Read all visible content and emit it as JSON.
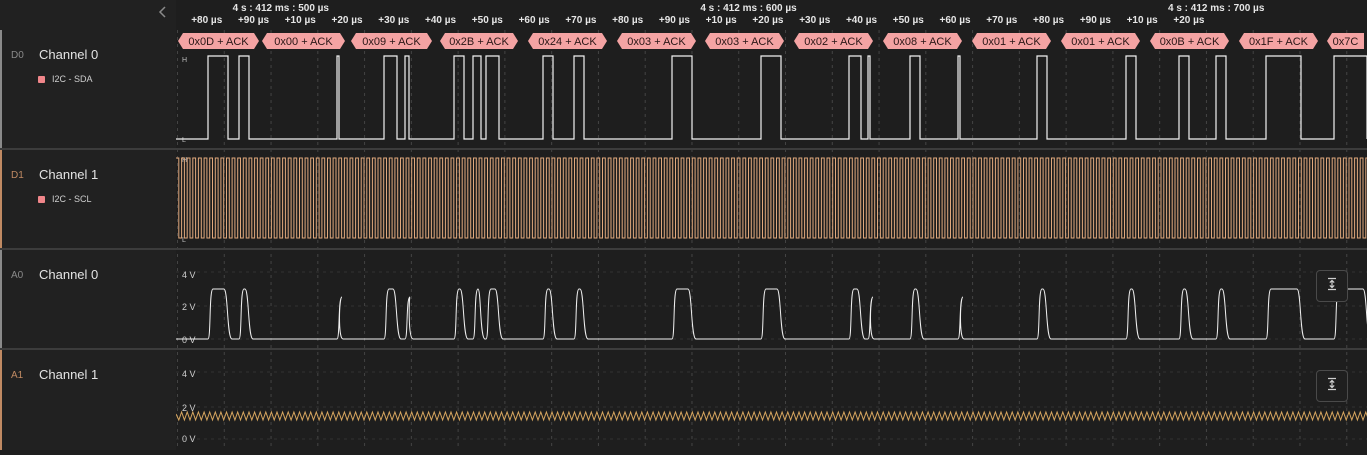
{
  "timeline": {
    "major_labels": [
      "4 s : 412 ms : 500 µs",
      "4 s : 412 ms : 600 µs",
      "4 s : 412 ms : 700 µs"
    ],
    "minor_labels": [
      "+80 µs",
      "+90 µs",
      "+10 µs",
      "+20 µs",
      "+30 µs",
      "+40 µs",
      "+50 µs",
      "+60 µs",
      "+70 µs",
      "+80 µs",
      "+90 µs",
      "+10 µs",
      "+20 µs",
      "+30 µs",
      "+40 µs",
      "+50 µs",
      "+60 µs",
      "+70 µs",
      "+80 µs",
      "+90 µs",
      "+10 µs",
      "+20 µs"
    ]
  },
  "channels": [
    {
      "id": "D0",
      "name": "Channel 0",
      "analyzer": "I2C - SDA",
      "level_high": "H",
      "level_low": "L"
    },
    {
      "id": "D1",
      "name": "Channel 1",
      "analyzer": "I2C - SCL",
      "level_high": "H",
      "level_low": "L"
    },
    {
      "id": "A0",
      "name": "Channel 0",
      "v_labels": [
        "4 V",
        "2 V",
        "0 V"
      ]
    },
    {
      "id": "A1",
      "name": "Channel 1",
      "v_labels": [
        "4 V",
        "2 V",
        "0 V"
      ]
    }
  ],
  "decode_frames": [
    "0x0D + ACK",
    "0x00 + ACK",
    "0x09 + ACK",
    "0x2B + ACK",
    "0x24 + ACK",
    "0x03 + ACK",
    "0x03 + ACK",
    "0x02 + ACK",
    "0x08 + ACK",
    "0x01 + ACK",
    "0x01 + ACK",
    "0x0B + ACK",
    "0x1F + ACK",
    "0x7C"
  ],
  "icons": {
    "collapse": "chevron-left-icon",
    "autoscale": "vertical-autoscale-icon"
  },
  "colors": {
    "background": "#1e1e1e",
    "sidebar": "#212121",
    "digital_trace": "#f2f2f2",
    "scl_trace": "#e0a87c",
    "analog_sda_trace": "#f0f0f0",
    "analog_scl_trace": "#d8a760",
    "decode_bubble": "#f4a3a3",
    "decode_text": "#2a1616",
    "grid": "#444444",
    "stripe_d0": "#8a8a8a",
    "stripe_d1": "#c08a63",
    "stripe_a0": "#8a8a8a",
    "stripe_a1": "#c08a63"
  }
}
